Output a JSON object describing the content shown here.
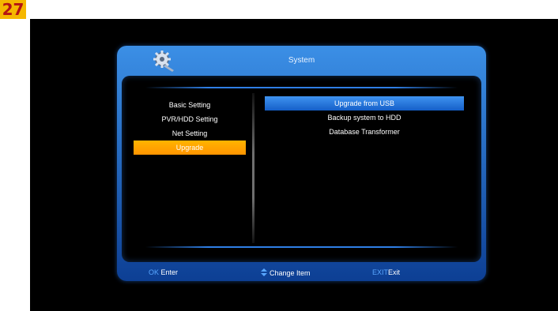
{
  "badge": "27",
  "window": {
    "title": "System"
  },
  "menu": [
    {
      "label": "Basic Setting"
    },
    {
      "label": "PVR/HDD Setting"
    },
    {
      "label": "Net Setting"
    },
    {
      "label": "Upgrade"
    }
  ],
  "options": [
    {
      "label": "Upgrade from USB"
    },
    {
      "label": "Backup system to HDD"
    },
    {
      "label": "Database Transformer"
    }
  ],
  "footer": {
    "ok_key": "OK",
    "ok_label": "Enter",
    "change_label": "Change Item",
    "exit_key": "EXIT",
    "exit_label": "Exit"
  },
  "colors": {
    "selected_left": "#ff9f00",
    "selected_right": "#2a7ae0",
    "frame": "#1f66c9",
    "key": "#58a6ff"
  },
  "icons": {
    "logo": "gear-wrench-icon",
    "nav": "up-down-arrow-icon"
  }
}
